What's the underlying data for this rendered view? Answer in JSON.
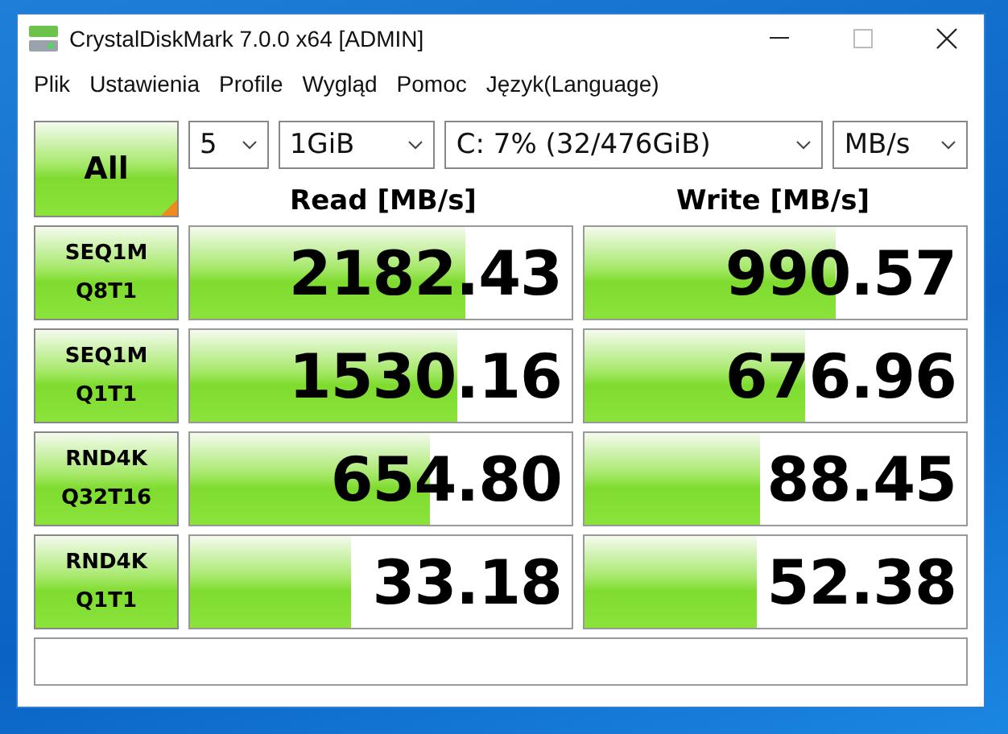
{
  "window": {
    "title": "CrystalDiskMark 7.0.0 x64 [ADMIN]"
  },
  "menu": [
    "Plik",
    "Ustawienia",
    "Profile",
    "Wygląd",
    "Pomoc",
    "Język(Language)"
  ],
  "all_button": "All",
  "selectors": [
    {
      "value": "5"
    },
    {
      "value": "1GiB"
    },
    {
      "value": "C: 7% (32/476GiB)"
    },
    {
      "value": "MB/s"
    }
  ],
  "headers": {
    "read": "Read [MB/s]",
    "write": "Write [MB/s]"
  },
  "tests": [
    {
      "name": "SEQ1M",
      "params": "Q8T1",
      "read": {
        "value": "2182.43",
        "level": 0.72
      },
      "write": {
        "value": "990.57",
        "level": 0.66
      }
    },
    {
      "name": "SEQ1M",
      "params": "Q1T1",
      "read": {
        "value": "1530.16",
        "level": 0.7
      },
      "write": {
        "value": "676.96",
        "level": 0.58
      }
    },
    {
      "name": "RND4K",
      "params": "Q32T16",
      "read": {
        "value": "654.80",
        "level": 0.63
      },
      "write": {
        "value": "88.45",
        "level": 0.46
      }
    },
    {
      "name": "RND4K",
      "params": "Q1T1",
      "read": {
        "value": "33.18",
        "level": 0.42
      },
      "write": {
        "value": "52.38",
        "level": 0.45
      }
    }
  ]
}
